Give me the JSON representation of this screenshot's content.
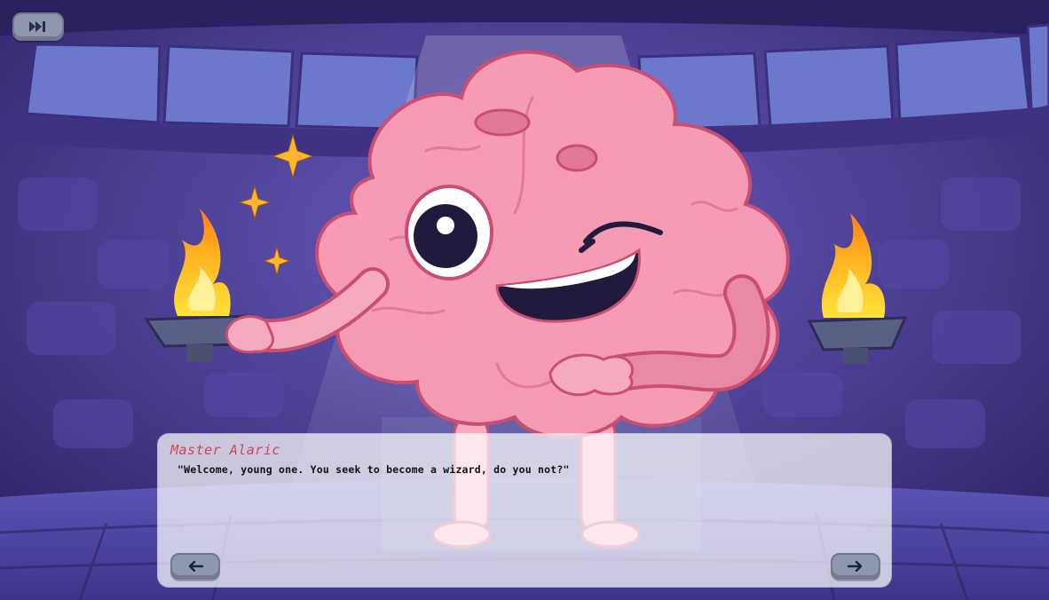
{
  "dialog": {
    "speaker": "Master Alaric",
    "line": "\"Welcome, young one. You seek to become a wizard, do you not?\""
  },
  "controls": {
    "skip_icon": "fast-forward-icon",
    "prev_icon": "arrow-left-icon",
    "next_icon": "arrow-right-icon"
  },
  "colors": {
    "wall": "#4a3e9a",
    "stone_light": "#6b76c6",
    "brain_pink": "#f59bb3",
    "brain_outline": "#c94e72",
    "fire": "#ffc425",
    "speaker_name": "#d0435a"
  }
}
